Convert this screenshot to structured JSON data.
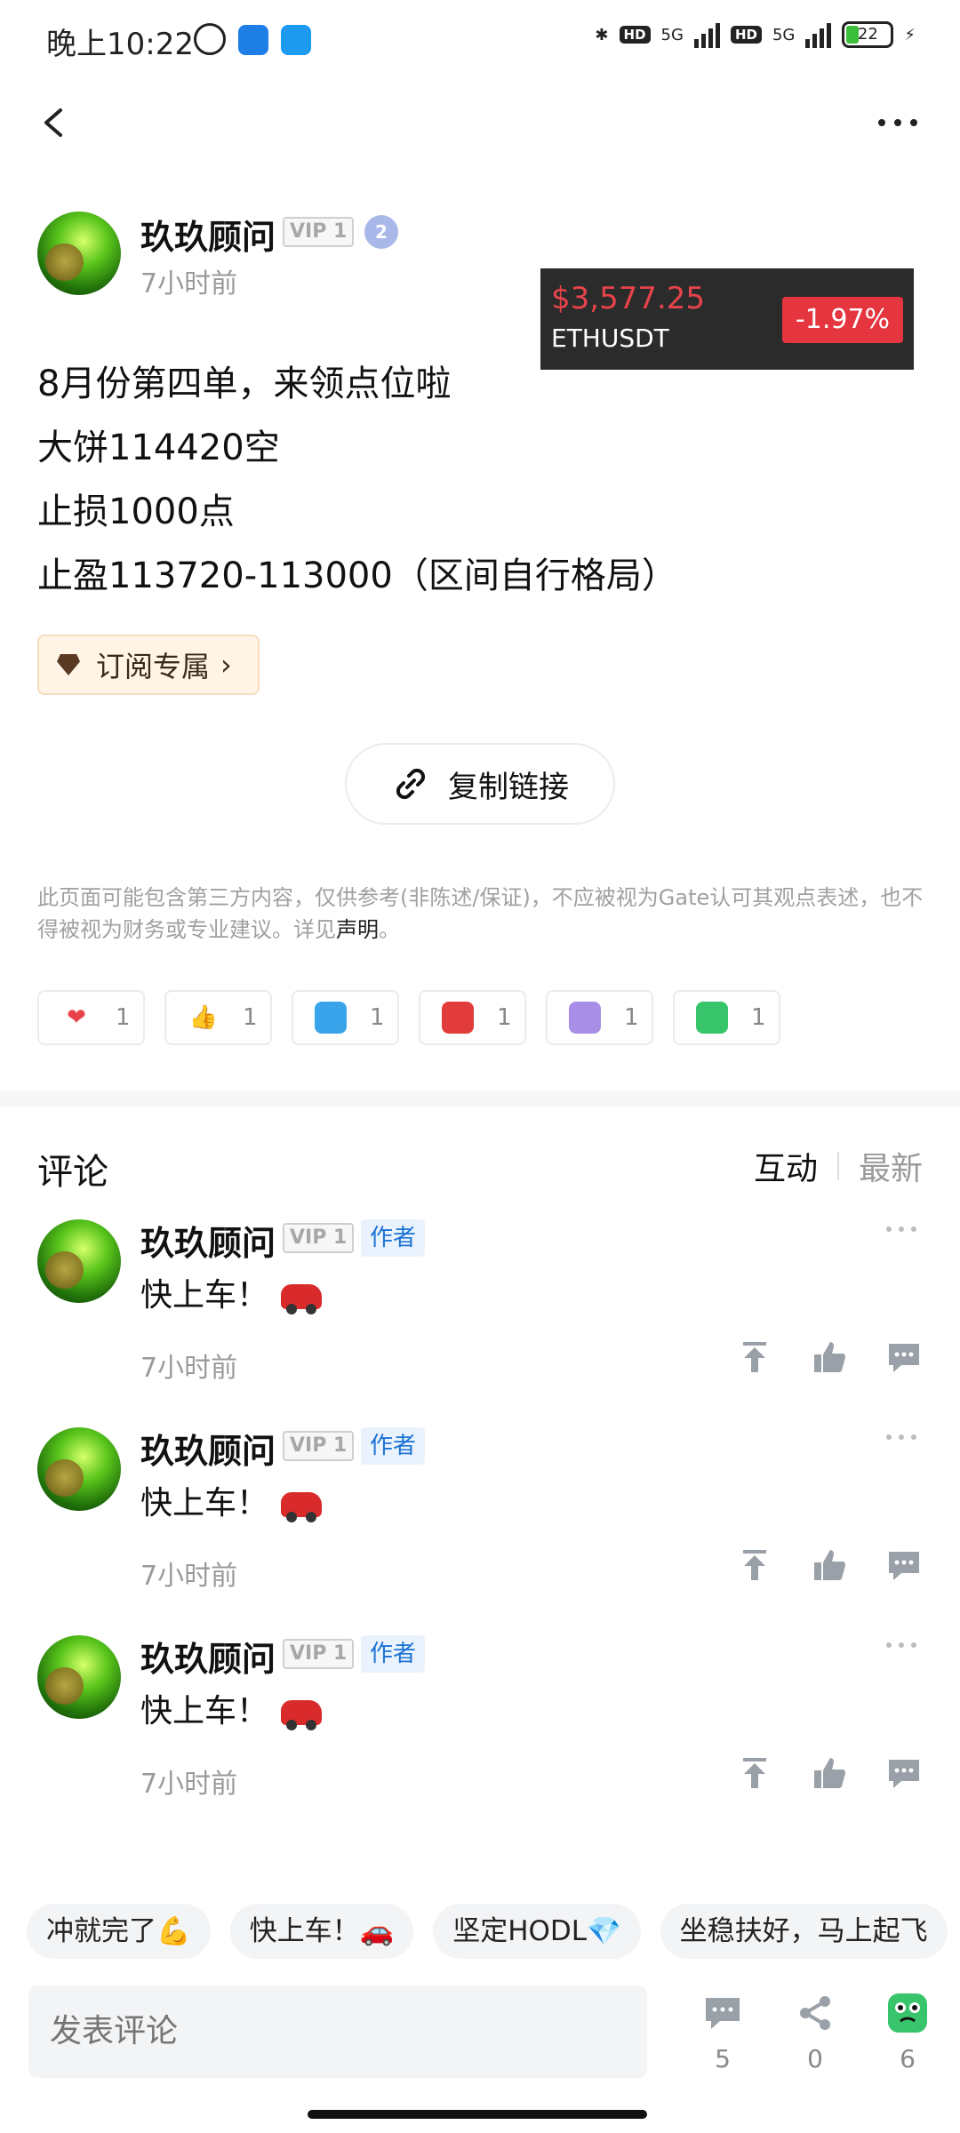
{
  "status_bar": {
    "time": "晚上10:22",
    "hd_label": "HD",
    "network_label": "5G",
    "battery_level": "22"
  },
  "author": {
    "name": "玖玖顾问",
    "vip_label": "VIP 1",
    "level": "2",
    "time": "7小时前"
  },
  "price_card": {
    "price": "$3,577.25",
    "symbol": "ETHUSDT",
    "change": "-1.97%"
  },
  "post": {
    "lines": [
      "8月份第四单，来领点位啦",
      "大饼114420空",
      "止损1000点",
      "止盈113720-113000（区间自行格局）"
    ]
  },
  "subscribe_label": "订阅专属",
  "copy_link_label": "复制链接",
  "disclaimer": {
    "text": "此页面可能包含第三方内容，仅供参考(非陈述/保证)，不应被视为Gate认可其观点表述，也不得被视为财务或专业建议。详见",
    "link": "声明",
    "end": "。"
  },
  "reactions": [
    {
      "emoji": "heart-emoji",
      "color": "#e8434b",
      "count": "1"
    },
    {
      "emoji": "thumbs-up-emoji",
      "color": "#f5b83d",
      "count": "1"
    },
    {
      "emoji": "hodl-emoji",
      "color": "#3aa4ea",
      "count": "1"
    },
    {
      "emoji": "angry-emoji",
      "color": "#e23b3b",
      "count": "1"
    },
    {
      "emoji": "purple-face-emoji",
      "color": "#a98ee8",
      "count": "1"
    },
    {
      "emoji": "green-face-emoji",
      "color": "#37c46b",
      "count": "1"
    }
  ],
  "comments_section": {
    "title": "评论",
    "tabs": [
      "互动",
      "最新"
    ]
  },
  "comments": [
    {
      "name": "玖玖顾问",
      "vip": "VIP 1",
      "role": "作者",
      "text": "快上车！",
      "time": "7小时前"
    },
    {
      "name": "玖玖顾问",
      "vip": "VIP 1",
      "role": "作者",
      "text": "快上车！",
      "time": "7小时前"
    },
    {
      "name": "玖玖顾问",
      "vip": "VIP 1",
      "role": "作者",
      "text": "快上车！",
      "time": "7小时前"
    }
  ],
  "quick_replies": [
    "冲就完了💪",
    "快上车！🚗",
    "坚定HODL💎",
    "坐稳扶好，马上起飞"
  ],
  "bottom_bar": {
    "placeholder": "发表评论",
    "comment_count": "5",
    "share_count": "0",
    "reaction_count": "6"
  }
}
